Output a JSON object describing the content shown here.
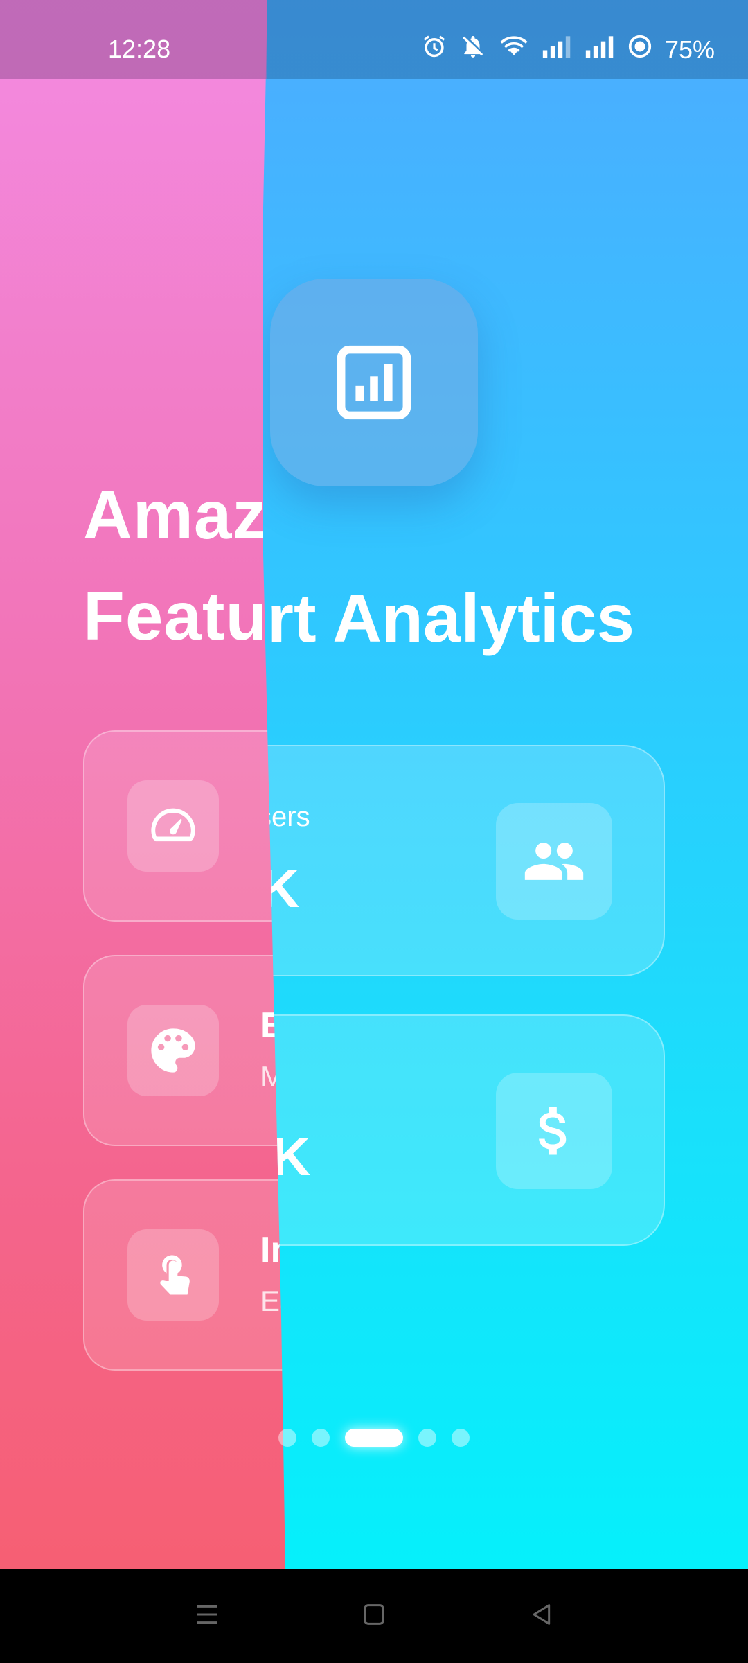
{
  "status_bar": {
    "time": "12:28",
    "battery": "75%",
    "icons": [
      "alarm-icon",
      "mute-icon",
      "wifi-icon",
      "signal-icon",
      "signal-icon",
      "battery-saver-icon"
    ]
  },
  "left_page": {
    "title_line1": "Amaz",
    "title_line2": "Featu",
    "features": [
      {
        "icon": "speedometer-icon",
        "title": "",
        "subtitle": ""
      },
      {
        "icon": "palette-icon",
        "title": "E",
        "subtitle": "M"
      },
      {
        "icon": "touch-icon",
        "title": "In",
        "subtitle": "Ea"
      }
    ],
    "gradient_colors": [
      "#f38be2",
      "#f65f73"
    ]
  },
  "right_page": {
    "icon": "analytics-chart-icon",
    "title": "rt Analytics",
    "stats": [
      {
        "label": "sers",
        "value": "K",
        "icon": "users-icon"
      },
      {
        "label": "",
        "value": "K",
        "icon": "dollar-icon"
      }
    ],
    "gradient_colors": [
      "#4dacff",
      "#05f0fb"
    ]
  },
  "pager": {
    "count": 5,
    "active_index": 2
  },
  "nav_bar": {
    "icons": [
      "menu-icon",
      "home-icon",
      "back-icon"
    ]
  }
}
